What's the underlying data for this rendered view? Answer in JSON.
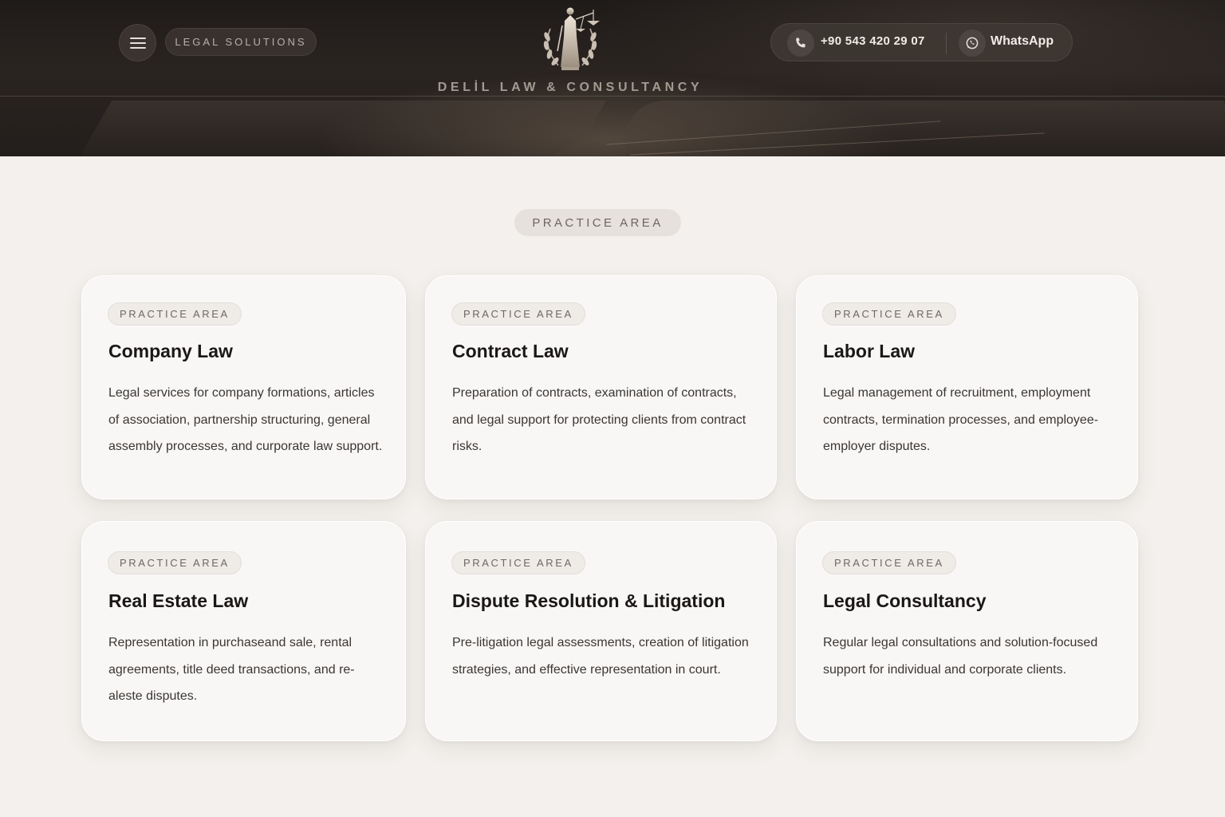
{
  "header": {
    "menu_icon": "hamburger-menu-icon",
    "tagline": "LEGAL SOLUTIONS",
    "brand": "DELİL LAW & CONSULTANCY",
    "logo_icon": "lady-justice-emblem-icon",
    "phone": "+90 543 420 29 07",
    "phone_icon": "phone-icon",
    "whatsapp_label": "WhatsApp",
    "whatsapp_icon": "whatsapp-icon"
  },
  "section": {
    "tag": "PRACTICE AREA"
  },
  "cards": [
    {
      "tag": "PRACTICE AREA",
      "title": "Company Law",
      "description": "Legal services for company formations, articles of association, partnership structuring, general assembly processes, and curporate law support."
    },
    {
      "tag": "PRACTICE AREA",
      "title": "Contract Law",
      "description": "Preparation of contracts, examination of contracts, and legal support for protecting clients from contract risks."
    },
    {
      "tag": "PRACTICE AREA",
      "title": "Labor Law",
      "description": "Legal management of recruitment, employment contracts, termination processes, and employee-employer disputes."
    },
    {
      "tag": "PRACTICE AREA",
      "title": "Real Estate Law",
      "description": "Representation in purchaseand sale, rental agreements, title deed transactions, and re-aleste disputes."
    },
    {
      "tag": "PRACTICE AREA",
      "title": "Dispute Resolution & Litigation",
      "description": "Pre-litigation legal assessments, creation of litigation strategies, and effective representation in court."
    },
    {
      "tag": "PRACTICE AREA",
      "title": "Legal Consultancy",
      "description": "Regular legal consultations and solution-focused support for individual and corporate clients."
    }
  ]
}
